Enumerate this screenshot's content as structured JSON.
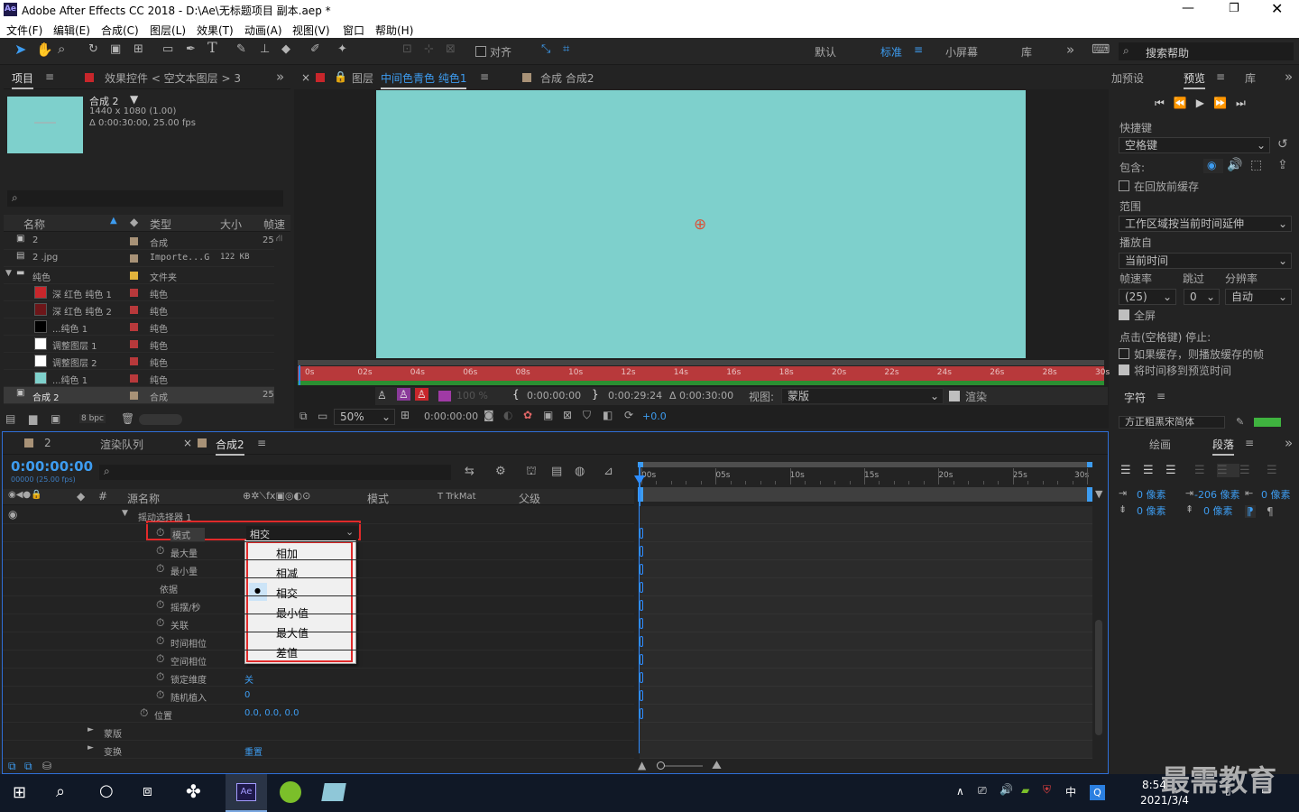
{
  "window": {
    "title": "Adobe After Effects CC 2018 - D:\\Ae\\无标题项目 副本.aep *",
    "app_icon": "Ae",
    "controls": [
      "minimize",
      "maximize",
      "close"
    ]
  },
  "menu": [
    "文件(F)",
    "编辑(E)",
    "合成(C)",
    "图层(L)",
    "效果(T)",
    "动画(A)",
    "视图(V)",
    "窗口",
    "帮助(H)"
  ],
  "toolbar": {
    "snap_label": "对齐",
    "workspaces": [
      "默认",
      "标准",
      "小屏幕",
      "库"
    ],
    "active_workspace": "标准",
    "search_placeholder": "搜索帮助"
  },
  "project_panel": {
    "tab_project": "项目",
    "tab_effects": "效果控件 < 空文本图层 > 3",
    "comp_name": "合成 2",
    "comp_size": "1440 x 1080 (1.00)",
    "comp_duration": "Δ 0:00:30:00, 25.00 fps",
    "columns": [
      "名称",
      "类型",
      "大小",
      "帧速"
    ],
    "items": [
      {
        "name": "2",
        "type": "合成",
        "size": "",
        "fps": "25",
        "color": "#a89277",
        "icon": "comp"
      },
      {
        "name": "2 .jpg",
        "type": "Importe...G",
        "size": "122 KB",
        "fps": "",
        "color": "#a89277",
        "icon": "file"
      },
      {
        "name": "纯色",
        "type": "文件夹",
        "size": "",
        "fps": "",
        "color": "#e1b33c",
        "icon": "folder"
      },
      {
        "name": "深 红色 纯色 1",
        "type": "纯色",
        "size": "",
        "fps": "",
        "color": "#b8393b",
        "swatch": "#c8262b"
      },
      {
        "name": "深 红色 纯色 2",
        "type": "纯色",
        "size": "",
        "fps": "",
        "color": "#b8393b",
        "swatch": "#6d1619"
      },
      {
        "name": "...纯色 1",
        "type": "纯色",
        "size": "",
        "fps": "",
        "color": "#b8393b",
        "swatch": "#000000"
      },
      {
        "name": "调整图层 1",
        "type": "纯色",
        "size": "",
        "fps": "",
        "color": "#b8393b",
        "swatch": "#ffffff"
      },
      {
        "name": "调整图层 2",
        "type": "纯色",
        "size": "",
        "fps": "",
        "color": "#b8393b",
        "swatch": "#ffffff"
      },
      {
        "name": "...纯色 1",
        "type": "纯色",
        "size": "",
        "fps": "",
        "color": "#b8393b",
        "swatch": "#7fd1cc"
      },
      {
        "name": "合成 2",
        "type": "合成",
        "size": "",
        "fps": "25",
        "color": "#a89277",
        "icon": "comp",
        "selected": true
      }
    ],
    "bpc": "8 bpc"
  },
  "viewer": {
    "tab_layer": "图层",
    "tab_layer_name": "中间色青色 纯色1",
    "tab_comp": "合成 合成2",
    "canvas_color": "#7ed0cc",
    "ruler": [
      "0s",
      "02s",
      "04s",
      "06s",
      "08s",
      "10s",
      "12s",
      "14s",
      "16s",
      "18s",
      "20s",
      "22s",
      "24s",
      "26s",
      "28s",
      "30s"
    ],
    "opacity": "100 %",
    "time_in": "0:00:00:00",
    "time_out": "0:00:29:24",
    "duration": "Δ 0:00:30:00",
    "view_label": "视图:",
    "view_value": "蒙版",
    "render_label": "渲染",
    "zoom": "50%",
    "current_time": "0:00:00:00",
    "exposure": "+0.0"
  },
  "preview_panel": {
    "tab_presets": "加预设",
    "tab_preview": "预览",
    "tab_library": "库",
    "shortcut_label": "快捷键",
    "shortcut_value": "空格键",
    "include_label": "包含:",
    "cache_label": "在回放前缓存",
    "range_label": "范围",
    "range_value": "工作区域按当前时间延伸",
    "play_from_label": "播放自",
    "play_from_value": "当前时间",
    "fps_label": "帧速率",
    "skip_label": "跳过",
    "res_label": "分辨率",
    "fps_value": "(25)",
    "skip_value": "0",
    "res_value": "自动",
    "fullscreen_label": "全屏",
    "stop_label": "点击(空格键) 停止:",
    "cache_play_label": "如果缓存，则播放缓存的帧",
    "move_time_label": "将时间移到预览时间",
    "char_tab": "字符",
    "font_partial": "方正粗黑宋简体"
  },
  "paragraph_panel": {
    "tab_draw": "绘画",
    "tab_paragraph": "段落",
    "indent_left": "0 像素",
    "indent_first": "-206 像素",
    "indent_right": "0 像素",
    "space_before": "0 像素",
    "space_after": "0 像素"
  },
  "timeline": {
    "tabs": [
      "2",
      "渲染队列",
      "合成2"
    ],
    "timecode": "0:00:00:00",
    "timecode_sub": "00000 (25.00 fps)",
    "columns": [
      "源名称",
      "模式",
      "T TrkMat",
      "父级"
    ],
    "rows": [
      {
        "indent": 150,
        "label": "摇动选择器 1",
        "arrow": "▼",
        "value": ""
      },
      {
        "indent": 186,
        "label": "模式",
        "stopwatch": true,
        "value": "相交",
        "highlight": true
      },
      {
        "indent": 186,
        "label": "最大量",
        "stopwatch": true,
        "value": ""
      },
      {
        "indent": 186,
        "label": "最小量",
        "stopwatch": true,
        "value": ""
      },
      {
        "indent": 174,
        "label": "依据",
        "stopwatch": false,
        "value": ""
      },
      {
        "indent": 186,
        "label": "摇摆/秒",
        "stopwatch": true,
        "value": ""
      },
      {
        "indent": 186,
        "label": "关联",
        "stopwatch": true,
        "value": ""
      },
      {
        "indent": 186,
        "label": "时间相位",
        "stopwatch": true,
        "value": ""
      },
      {
        "indent": 186,
        "label": "空间相位",
        "stopwatch": true,
        "value": ""
      },
      {
        "indent": 186,
        "label": "锁定维度",
        "stopwatch": true,
        "value": "关"
      },
      {
        "indent": 186,
        "label": "随机植入",
        "stopwatch": true,
        "value": "0"
      },
      {
        "indent": 168,
        "label": "位置",
        "stopwatch": true,
        "value": "0.0, 0.0, 0.0"
      },
      {
        "indent": 112,
        "label": "蒙版",
        "arrow": "►",
        "value": ""
      },
      {
        "indent": 112,
        "label": "变换",
        "arrow": "►",
        "value": "重置"
      }
    ],
    "ruler": [
      "00s",
      "05s",
      "10s",
      "15s",
      "20s",
      "25s",
      "30s"
    ],
    "dropdown_options": [
      "相加",
      "相减",
      "相交",
      "最小值",
      "最大值",
      "差值"
    ],
    "dropdown_selected": "相交"
  },
  "taskbar": {
    "time": "8:54",
    "date": "2021/3/4",
    "ime": "中",
    "watermark": "最需教育"
  }
}
